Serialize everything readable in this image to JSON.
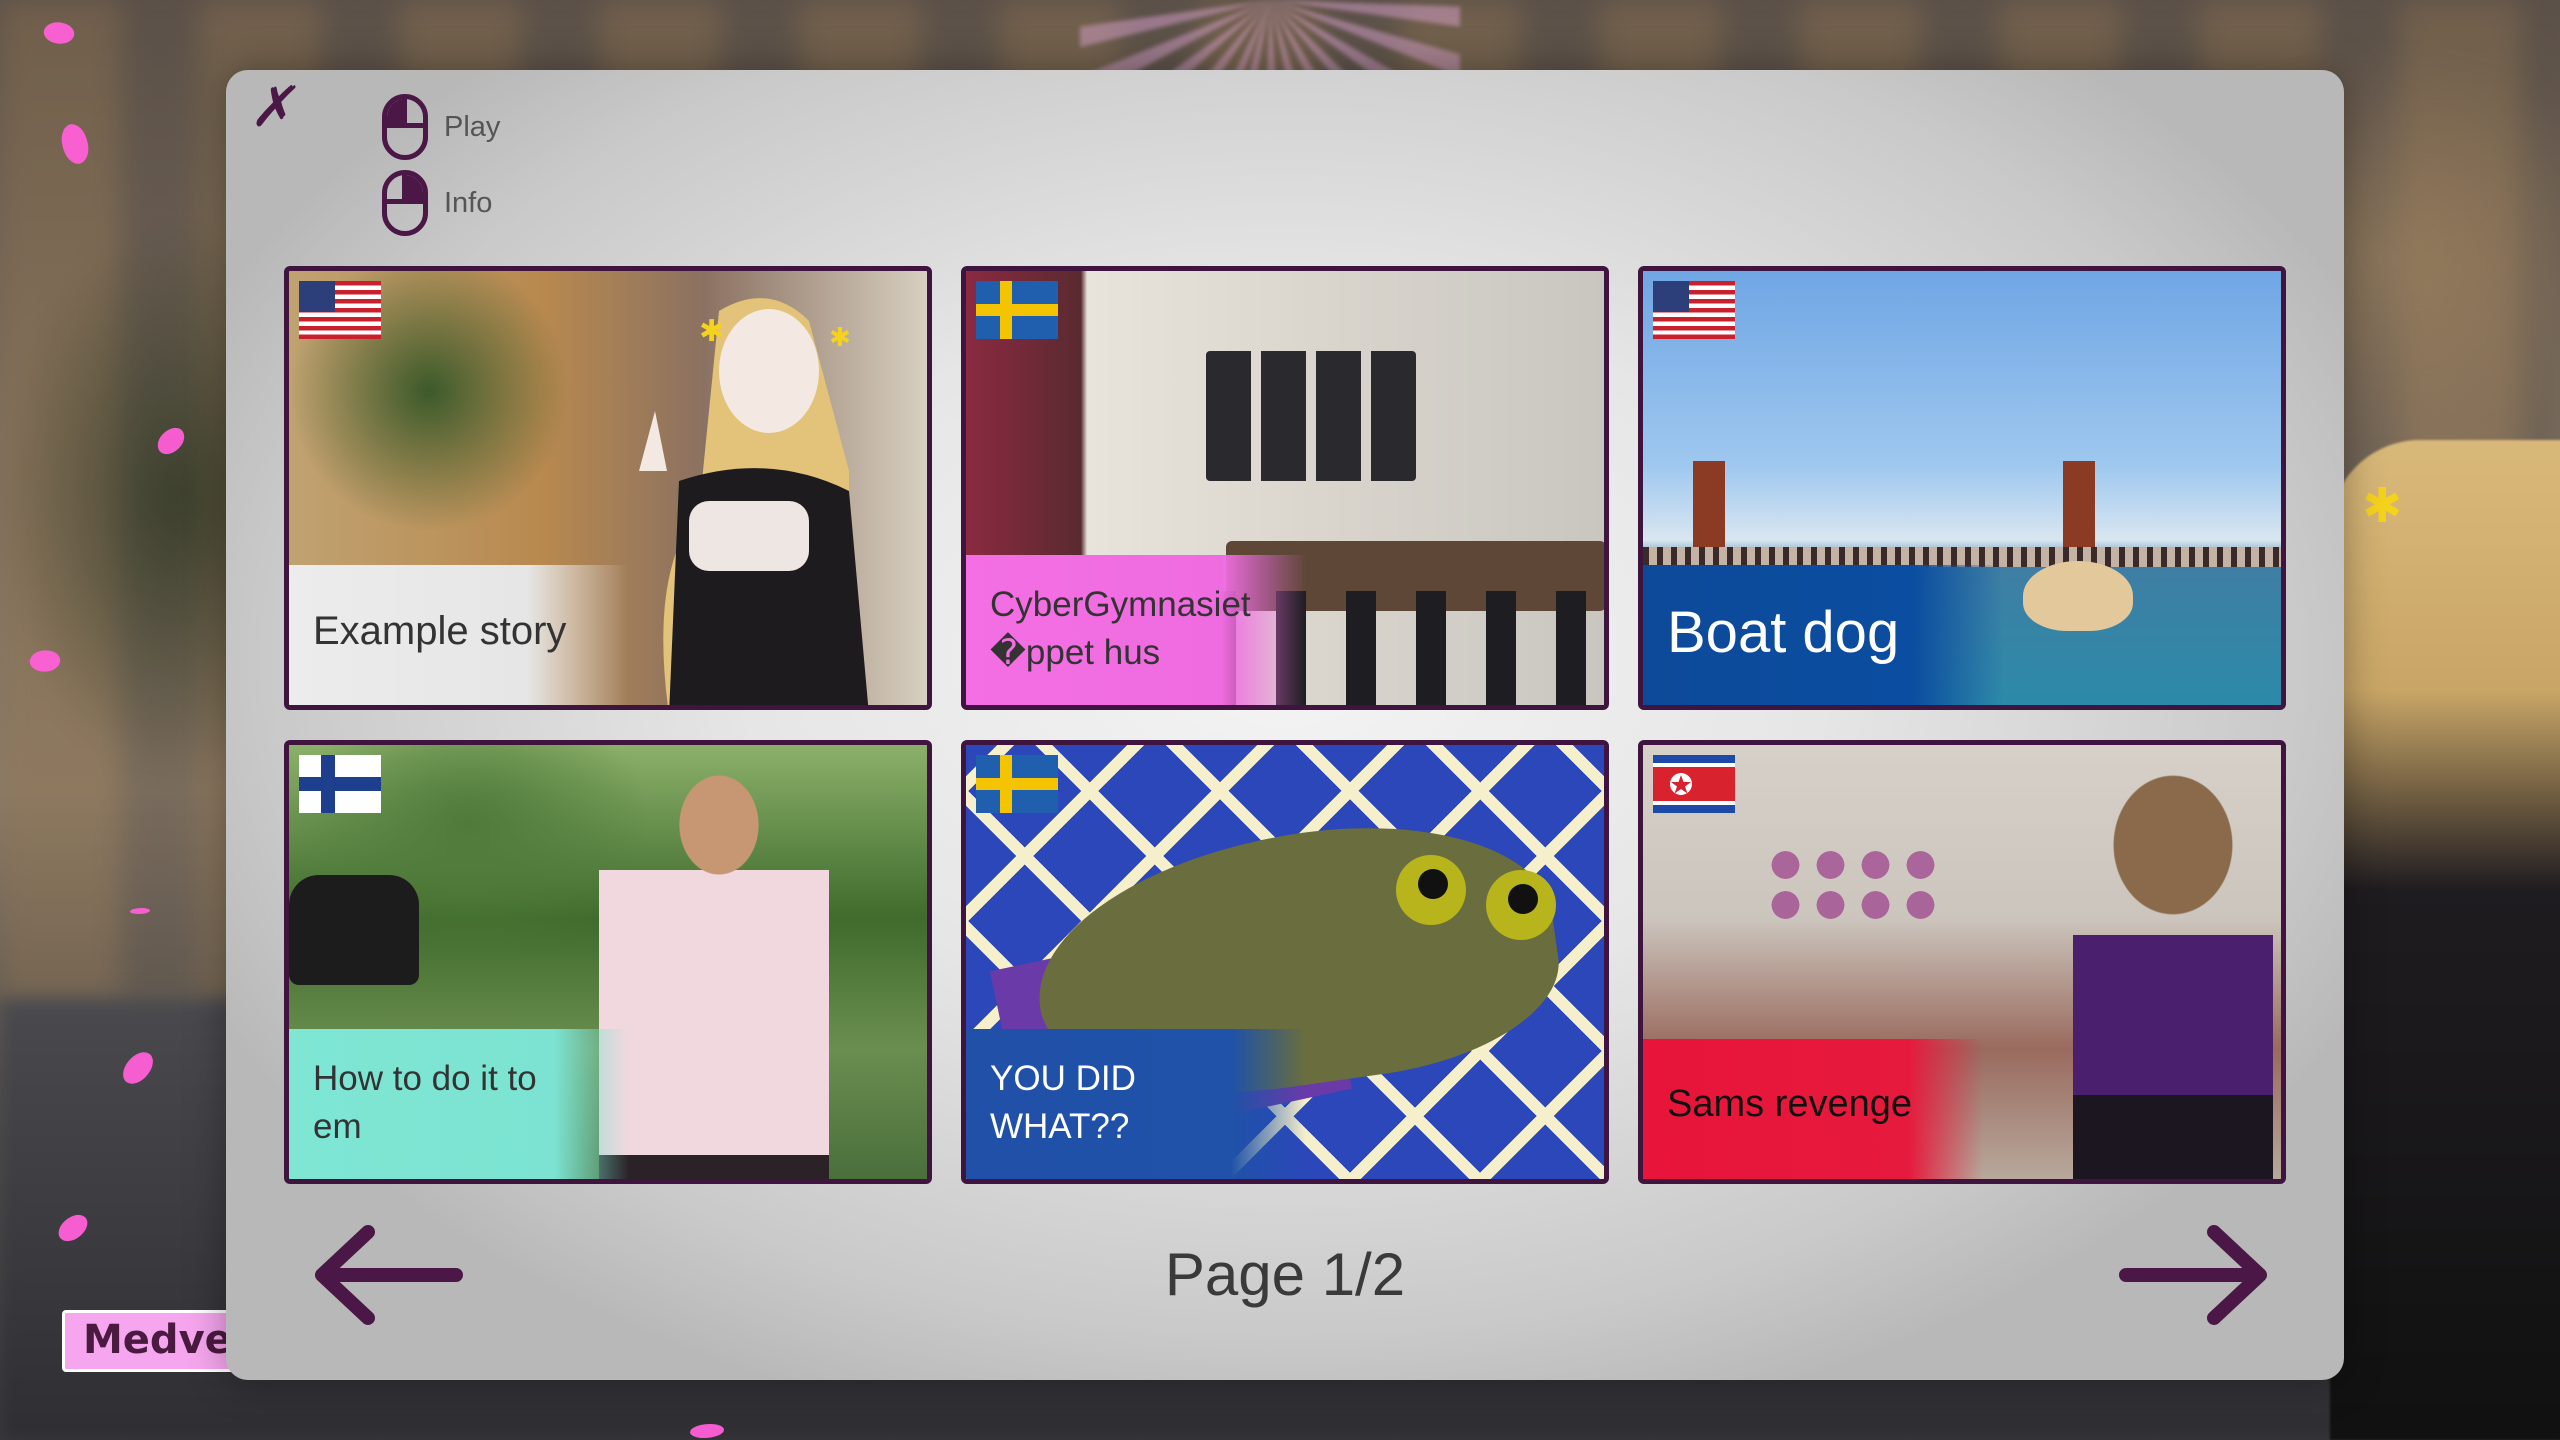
{
  "hints": {
    "play_label": "Play",
    "info_label": "Info"
  },
  "stories": [
    {
      "title": "Example story",
      "flag": "us-flag"
    },
    {
      "title": "CyberGymnasiet\n�ppet hus",
      "title_line1": "CyberGymnasiet",
      "title_line2": "�ppet hus",
      "flag": "sweden-flag"
    },
    {
      "title": "Boat dog",
      "flag": "us-flag"
    },
    {
      "title": "How to do it to em",
      "title_line1": "How to do it to",
      "title_line2": "em",
      "flag": "finland-flag"
    },
    {
      "title": "YOU DID WHAT??",
      "title_line1": "YOU DID",
      "title_line2": "WHAT??",
      "flag": "sweden-flag"
    },
    {
      "title": "Sams revenge",
      "flag": "north-korea-flag"
    }
  ],
  "pagination": {
    "page_label": "Page 1/2",
    "prev_icon": "arrow-left-icon",
    "next_icon": "arrow-right-icon"
  },
  "background": {
    "name_tag": "Medve"
  },
  "colors": {
    "accent": "#4a1746",
    "card_border": "#3f1540",
    "caption_pink": "#ef6ce0",
    "caption_blue": "#0b4da0",
    "caption_teal": "#7ce3d2",
    "caption_red": "#e61a3c"
  }
}
